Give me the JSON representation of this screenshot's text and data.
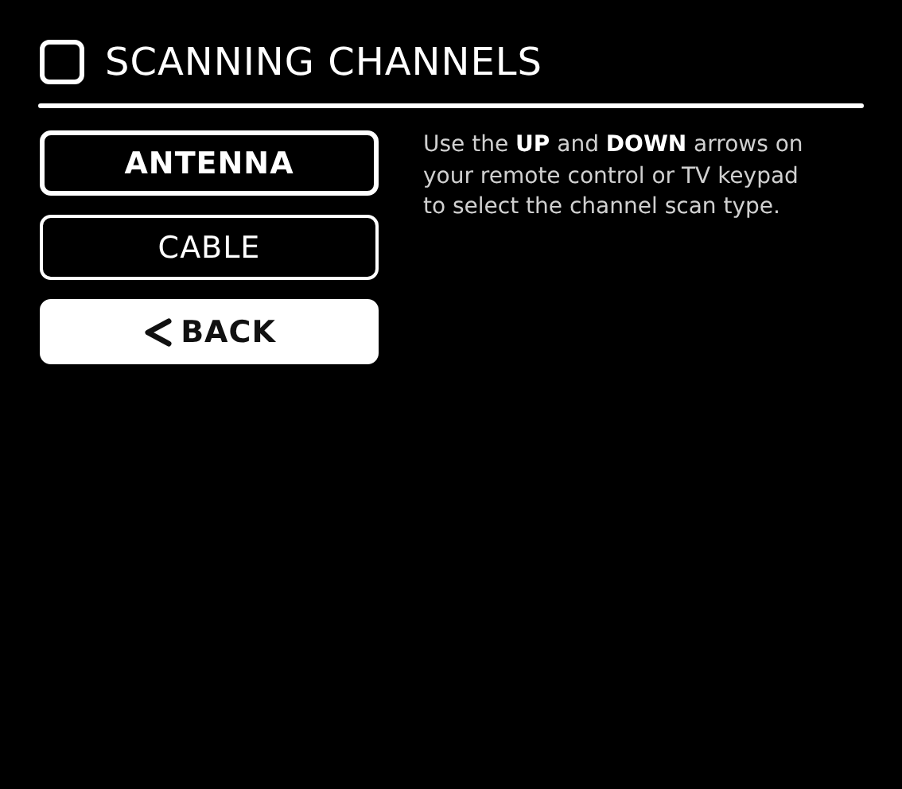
{
  "title": "SCANNING CHANNELS",
  "options": [
    {
      "label": "ANTENNA",
      "kind": "option",
      "selected": true,
      "focused": false
    },
    {
      "label": "CABLE",
      "kind": "option",
      "selected": false,
      "focused": false
    },
    {
      "label": "BACK",
      "kind": "back",
      "focused": true
    }
  ],
  "help_text": "Use the **UP** and **DOWN** arrows on your remote control or TV keypad to select the channel scan type."
}
